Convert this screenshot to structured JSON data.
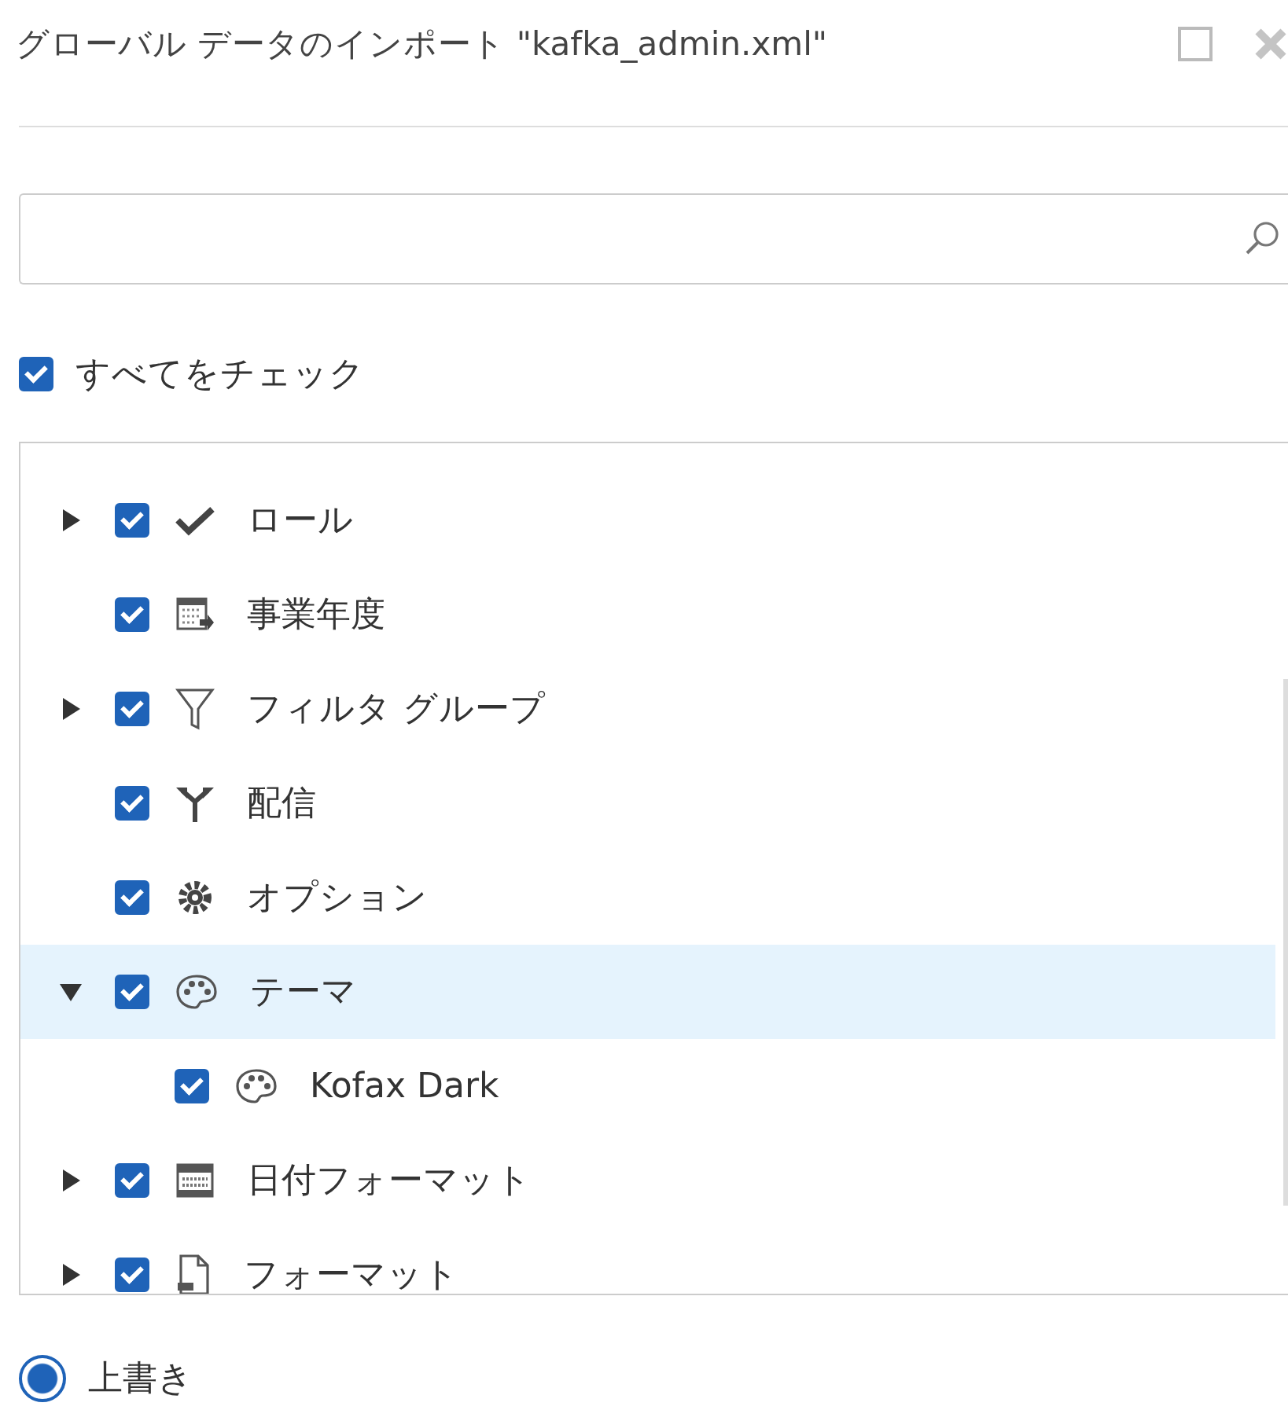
{
  "window": {
    "title": "グローバル データのインポート \"kafka_admin.xml\""
  },
  "check_all": {
    "label": "すべてをチェック",
    "checked": true
  },
  "tree": {
    "items": [
      {
        "label": "ロール",
        "checked": true,
        "expanded": false,
        "selected": false
      },
      {
        "label": "事業年度",
        "checked": true,
        "selected": false
      },
      {
        "label": "フィルタ グループ",
        "checked": true,
        "expanded": false,
        "selected": false
      },
      {
        "label": "配信",
        "checked": true,
        "selected": false
      },
      {
        "label": "オプション",
        "checked": true,
        "selected": false
      },
      {
        "label": "テーマ",
        "checked": true,
        "expanded": true,
        "selected": true,
        "children": [
          {
            "label": "Kofax Dark",
            "checked": true,
            "selected": false
          }
        ]
      },
      {
        "label": "日付フォーマット",
        "checked": true,
        "expanded": false,
        "selected": false
      },
      {
        "label": "フォーマット",
        "checked": true,
        "expanded": false,
        "selected": false
      }
    ]
  },
  "mode": {
    "options": [
      {
        "label": "上書き",
        "selected": true
      }
    ]
  }
}
